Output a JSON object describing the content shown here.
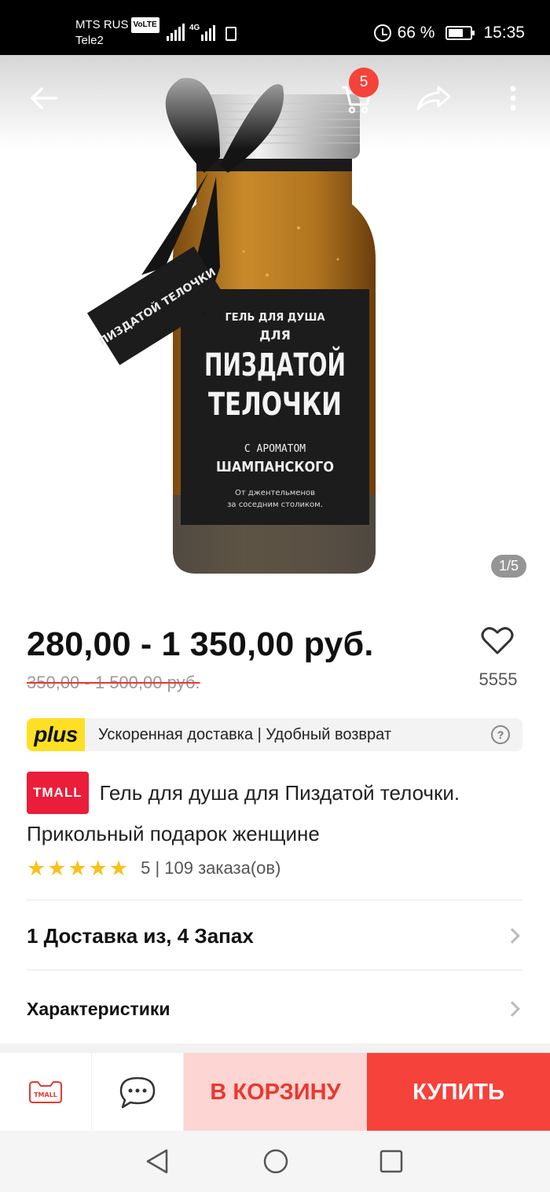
{
  "status_bar": {
    "carrier1": "MTS RUS",
    "volte": "VoLTE",
    "carrier2": "Tele2",
    "network": "4G",
    "battery_percent": "66 %",
    "time": "15:35"
  },
  "header": {
    "cart_count": "5",
    "image_counter": "1/5"
  },
  "product_image": {
    "label_line1": "ГЕЛЬ ДЛЯ ДУША",
    "label_line2": "ДЛЯ",
    "label_line3": "ПИЗДАТОЙ",
    "label_line4": "ТЕЛОЧКИ",
    "label_line5": "С АРОМАТОМ",
    "label_line6": "ШАМПАНСКОГО",
    "label_line7": "От джентельменов",
    "label_line8": "за соседним столиком.",
    "tag_text": "ПИЗДАТОЙ ТЕЛОЧКИ"
  },
  "price": {
    "current": "280,00 - 1 350,00 руб.",
    "old": "350,00 - 1 500,00 руб.",
    "favorites_count": "5555"
  },
  "plus": {
    "logo": "plus",
    "text": "Ускоренная доставка | Удобный возврат",
    "help": "?"
  },
  "product": {
    "badge": "TMALL",
    "title": "Гель для душа для Пиздатой телочки. Прикольный подарок женщине",
    "rating": "5",
    "orders": "5 | 109 заказа(ов)"
  },
  "options_row": {
    "label": "1 Доставка из, 4 Запах"
  },
  "specs_row": {
    "label": "Характеристики"
  },
  "action_bar": {
    "store_icon_label": "TMALL",
    "add_to_cart": "В КОРЗИНУ",
    "buy": "КУПИТЬ"
  },
  "colors": {
    "accent_red": "#f5423a",
    "cart_bg": "#fdd5d3",
    "plus_yellow": "#fde023",
    "star": "#f8c21c"
  }
}
